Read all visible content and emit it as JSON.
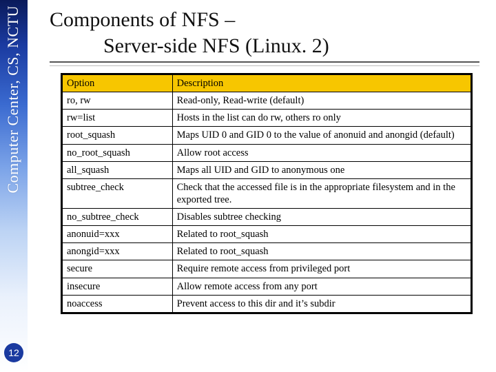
{
  "sidebar": {
    "org_text": "Computer Center, CS, NCTU",
    "org_fade": "",
    "page_number": "12"
  },
  "title": {
    "line1": "Components of NFS –",
    "line2": "Server-side NFS (Linux. 2)"
  },
  "table_headers": {
    "col1": "Option",
    "col2": "Description"
  },
  "chart_data": {
    "type": "table",
    "title": "NFS server-side export options (Linux)",
    "columns": [
      "Option",
      "Description"
    ],
    "rows": [
      [
        "ro, rw",
        "Read-only, Read-write (default)"
      ],
      [
        "rw=list",
        "Hosts in the list can do rw, others ro only"
      ],
      [
        "root_squash",
        "Maps UID 0 and GID 0 to the value of anonuid and anongid (default)"
      ],
      [
        "no_root_squash",
        "Allow root access"
      ],
      [
        "all_squash",
        "Maps all UID and GID to anonymous one"
      ],
      [
        "subtree_check",
        "Check that the accessed file is in the appropriate filesystem and in the exported tree."
      ],
      [
        "no_subtree_check",
        "Disables subtree checking"
      ],
      [
        "anonuid=xxx",
        "Related to root_squash"
      ],
      [
        "anongid=xxx",
        "Related to root_squash"
      ],
      [
        "secure",
        "Require remote access from privileged port"
      ],
      [
        "insecure",
        "Allow remote access from any port"
      ],
      [
        "noaccess",
        "Prevent access to this dir and it’s subdir"
      ]
    ]
  }
}
